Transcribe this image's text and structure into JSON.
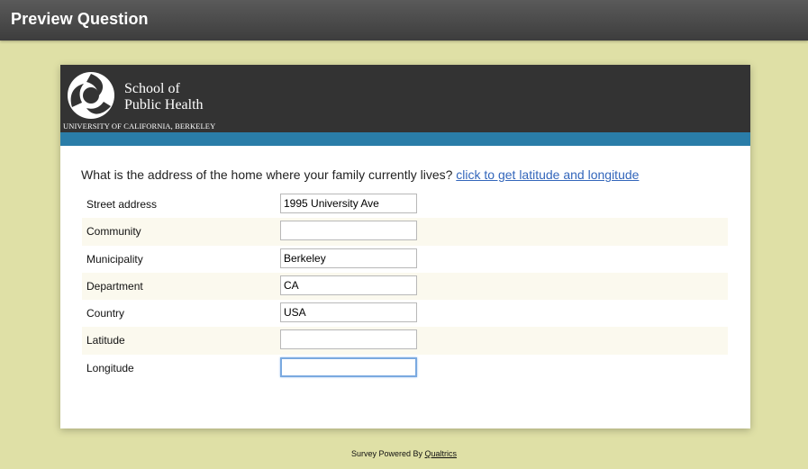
{
  "topbar": {
    "title": "Preview Question"
  },
  "header": {
    "logo_icon": "uc-berkeley-sph-logo",
    "line1": "School of",
    "line2": "Public Health",
    "subline": "UNIVERSITY OF CALIFORNIA, BERKELEY",
    "colors": {
      "banner": "#333333",
      "stripe": "#2a7da8"
    }
  },
  "question": {
    "text": "What is the address of the home where your family currently lives?",
    "link": "click to get latitude and longitude"
  },
  "fields": [
    {
      "label": "Street address",
      "value": "1995 University Ave"
    },
    {
      "label": "Community",
      "value": ""
    },
    {
      "label": "Municipality",
      "value": "Berkeley"
    },
    {
      "label": "Department",
      "value": "CA"
    },
    {
      "label": "Country",
      "value": "USA"
    },
    {
      "label": "Latitude",
      "value": ""
    },
    {
      "label": "Longitude",
      "value": ""
    }
  ],
  "footer": {
    "prefix": "Survey Powered By",
    "link": "Qualtrics"
  }
}
